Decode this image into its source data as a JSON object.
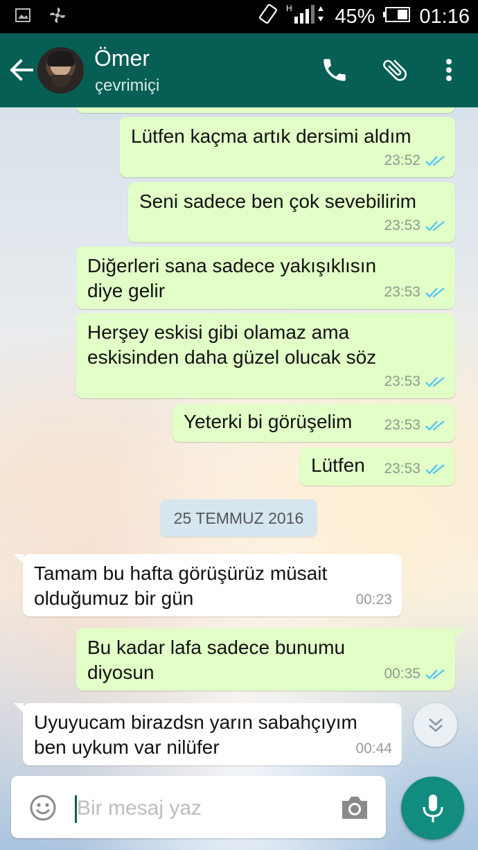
{
  "status_bar": {
    "battery_percent": "45%",
    "time": "01:16",
    "network": "H"
  },
  "header": {
    "contact_name": "Ömer",
    "contact_status": "çevrimiçi"
  },
  "messages": [
    {
      "direction": "outgoing",
      "lines": [
        "Lütfen kaçma artık dersimi aldım"
      ],
      "time": "23:52",
      "read": true
    },
    {
      "direction": "outgoing",
      "lines": [
        "Seni sadece ben çok sevebilirim"
      ],
      "time": "23:53",
      "read": true
    },
    {
      "direction": "outgoing",
      "lines": [
        "Diğerleri sana sadece yakışıklısın",
        "diye gelir"
      ],
      "time": "23:53",
      "read": true
    },
    {
      "direction": "outgoing",
      "lines": [
        "Herşey eskisi gibi olamaz ama",
        "eskisinden daha güzel olucak söz"
      ],
      "time": "23:53",
      "read": true
    },
    {
      "direction": "outgoing",
      "lines": [
        "Yeterki bi görüşelim"
      ],
      "time": "23:53",
      "read": true
    },
    {
      "direction": "outgoing",
      "lines": [
        "Lütfen"
      ],
      "time": "23:53",
      "read": true
    },
    {
      "direction": "incoming",
      "lines": [
        "Tamam bu hafta görüşürüz müsait",
        "olduğumuz bir gün"
      ],
      "time": "00:23"
    },
    {
      "direction": "outgoing",
      "lines": [
        "Bu kadar lafa sadece bunumu",
        "diyosun"
      ],
      "time": "00:35",
      "read": true
    },
    {
      "direction": "incoming",
      "lines": [
        "Uyuyucam birazdsn yarın sabahçıyım",
        "ben uykum var nilüfer"
      ],
      "time": "00:44"
    }
  ],
  "date_separator": "25 TEMMUZ 2016",
  "composer": {
    "placeholder": "Bir mesaj yaz"
  },
  "icons": {
    "back": "arrow-left-icon",
    "call": "phone-icon",
    "attach": "paperclip-icon",
    "menu": "more-vert-icon",
    "emoji": "emoji-icon",
    "camera": "camera-icon",
    "mic": "mic-icon",
    "scroll": "chevron-double-down-icon"
  },
  "colors": {
    "appbar": "#075e54",
    "outgoing_bubble": "#e1ffc7",
    "incoming_bubble": "#ffffff",
    "read_ticks": "#4fc3f7",
    "mic_button": "#128c7e"
  }
}
